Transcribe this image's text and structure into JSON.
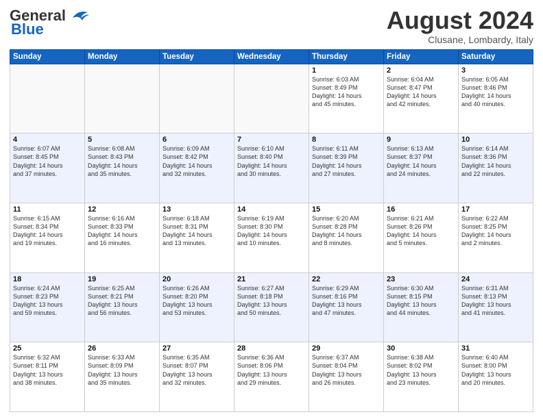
{
  "header": {
    "logo_line1": "General",
    "logo_line2": "Blue",
    "month": "August 2024",
    "location": "Clusane, Lombardy, Italy"
  },
  "weekdays": [
    "Sunday",
    "Monday",
    "Tuesday",
    "Wednesday",
    "Thursday",
    "Friday",
    "Saturday"
  ],
  "weeks": [
    [
      {
        "day": "",
        "info": ""
      },
      {
        "day": "",
        "info": ""
      },
      {
        "day": "",
        "info": ""
      },
      {
        "day": "",
        "info": ""
      },
      {
        "day": "1",
        "info": "Sunrise: 6:03 AM\nSunset: 8:49 PM\nDaylight: 14 hours\nand 45 minutes."
      },
      {
        "day": "2",
        "info": "Sunrise: 6:04 AM\nSunset: 8:47 PM\nDaylight: 14 hours\nand 42 minutes."
      },
      {
        "day": "3",
        "info": "Sunrise: 6:05 AM\nSunset: 8:46 PM\nDaylight: 14 hours\nand 40 minutes."
      }
    ],
    [
      {
        "day": "4",
        "info": "Sunrise: 6:07 AM\nSunset: 8:45 PM\nDaylight: 14 hours\nand 37 minutes."
      },
      {
        "day": "5",
        "info": "Sunrise: 6:08 AM\nSunset: 8:43 PM\nDaylight: 14 hours\nand 35 minutes."
      },
      {
        "day": "6",
        "info": "Sunrise: 6:09 AM\nSunset: 8:42 PM\nDaylight: 14 hours\nand 32 minutes."
      },
      {
        "day": "7",
        "info": "Sunrise: 6:10 AM\nSunset: 8:40 PM\nDaylight: 14 hours\nand 30 minutes."
      },
      {
        "day": "8",
        "info": "Sunrise: 6:11 AM\nSunset: 8:39 PM\nDaylight: 14 hours\nand 27 minutes."
      },
      {
        "day": "9",
        "info": "Sunrise: 6:13 AM\nSunset: 8:37 PM\nDaylight: 14 hours\nand 24 minutes."
      },
      {
        "day": "10",
        "info": "Sunrise: 6:14 AM\nSunset: 8:36 PM\nDaylight: 14 hours\nand 22 minutes."
      }
    ],
    [
      {
        "day": "11",
        "info": "Sunrise: 6:15 AM\nSunset: 8:34 PM\nDaylight: 14 hours\nand 19 minutes."
      },
      {
        "day": "12",
        "info": "Sunrise: 6:16 AM\nSunset: 8:33 PM\nDaylight: 14 hours\nand 16 minutes."
      },
      {
        "day": "13",
        "info": "Sunrise: 6:18 AM\nSunset: 8:31 PM\nDaylight: 14 hours\nand 13 minutes."
      },
      {
        "day": "14",
        "info": "Sunrise: 6:19 AM\nSunset: 8:30 PM\nDaylight: 14 hours\nand 10 minutes."
      },
      {
        "day": "15",
        "info": "Sunrise: 6:20 AM\nSunset: 8:28 PM\nDaylight: 14 hours\nand 8 minutes."
      },
      {
        "day": "16",
        "info": "Sunrise: 6:21 AM\nSunset: 8:26 PM\nDaylight: 14 hours\nand 5 minutes."
      },
      {
        "day": "17",
        "info": "Sunrise: 6:22 AM\nSunset: 8:25 PM\nDaylight: 14 hours\nand 2 minutes."
      }
    ],
    [
      {
        "day": "18",
        "info": "Sunrise: 6:24 AM\nSunset: 8:23 PM\nDaylight: 13 hours\nand 59 minutes."
      },
      {
        "day": "19",
        "info": "Sunrise: 6:25 AM\nSunset: 8:21 PM\nDaylight: 13 hours\nand 56 minutes."
      },
      {
        "day": "20",
        "info": "Sunrise: 6:26 AM\nSunset: 8:20 PM\nDaylight: 13 hours\nand 53 minutes."
      },
      {
        "day": "21",
        "info": "Sunrise: 6:27 AM\nSunset: 8:18 PM\nDaylight: 13 hours\nand 50 minutes."
      },
      {
        "day": "22",
        "info": "Sunrise: 6:29 AM\nSunset: 8:16 PM\nDaylight: 13 hours\nand 47 minutes."
      },
      {
        "day": "23",
        "info": "Sunrise: 6:30 AM\nSunset: 8:15 PM\nDaylight: 13 hours\nand 44 minutes."
      },
      {
        "day": "24",
        "info": "Sunrise: 6:31 AM\nSunset: 8:13 PM\nDaylight: 13 hours\nand 41 minutes."
      }
    ],
    [
      {
        "day": "25",
        "info": "Sunrise: 6:32 AM\nSunset: 8:11 PM\nDaylight: 13 hours\nand 38 minutes."
      },
      {
        "day": "26",
        "info": "Sunrise: 6:33 AM\nSunset: 8:09 PM\nDaylight: 13 hours\nand 35 minutes."
      },
      {
        "day": "27",
        "info": "Sunrise: 6:35 AM\nSunset: 8:07 PM\nDaylight: 13 hours\nand 32 minutes."
      },
      {
        "day": "28",
        "info": "Sunrise: 6:36 AM\nSunset: 8:06 PM\nDaylight: 13 hours\nand 29 minutes."
      },
      {
        "day": "29",
        "info": "Sunrise: 6:37 AM\nSunset: 8:04 PM\nDaylight: 13 hours\nand 26 minutes."
      },
      {
        "day": "30",
        "info": "Sunrise: 6:38 AM\nSunset: 8:02 PM\nDaylight: 13 hours\nand 23 minutes."
      },
      {
        "day": "31",
        "info": "Sunrise: 6:40 AM\nSunset: 8:00 PM\nDaylight: 13 hours\nand 20 minutes."
      }
    ]
  ]
}
